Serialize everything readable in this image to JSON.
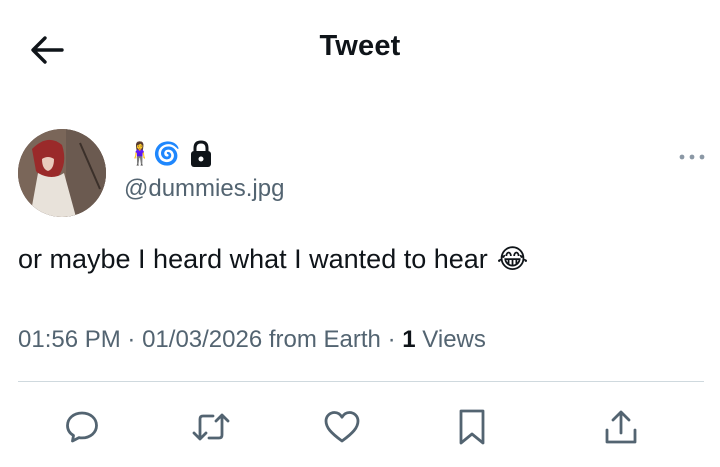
{
  "header": {
    "title": "Tweet",
    "back_icon": "arrow-left-icon"
  },
  "author": {
    "emoji_name": "🧍‍♀️🌀",
    "lock_icon": "lock-icon",
    "handle": "@dummies.jpg"
  },
  "tweet": {
    "text": "or maybe I heard what I wanted to hear",
    "emoji": "😂",
    "time": "01:56 PM",
    "date": "01/03/2026",
    "source": "from Earth",
    "views_count": "1",
    "views_label": "Views"
  },
  "actions": [
    {
      "icon": "reply-icon"
    },
    {
      "icon": "retweet-icon"
    },
    {
      "icon": "like-icon"
    },
    {
      "icon": "bookmark-icon"
    },
    {
      "icon": "share-icon"
    }
  ],
  "colors": {
    "text": "#0f1419",
    "secondary": "#536471",
    "divider": "#cfd9de"
  }
}
